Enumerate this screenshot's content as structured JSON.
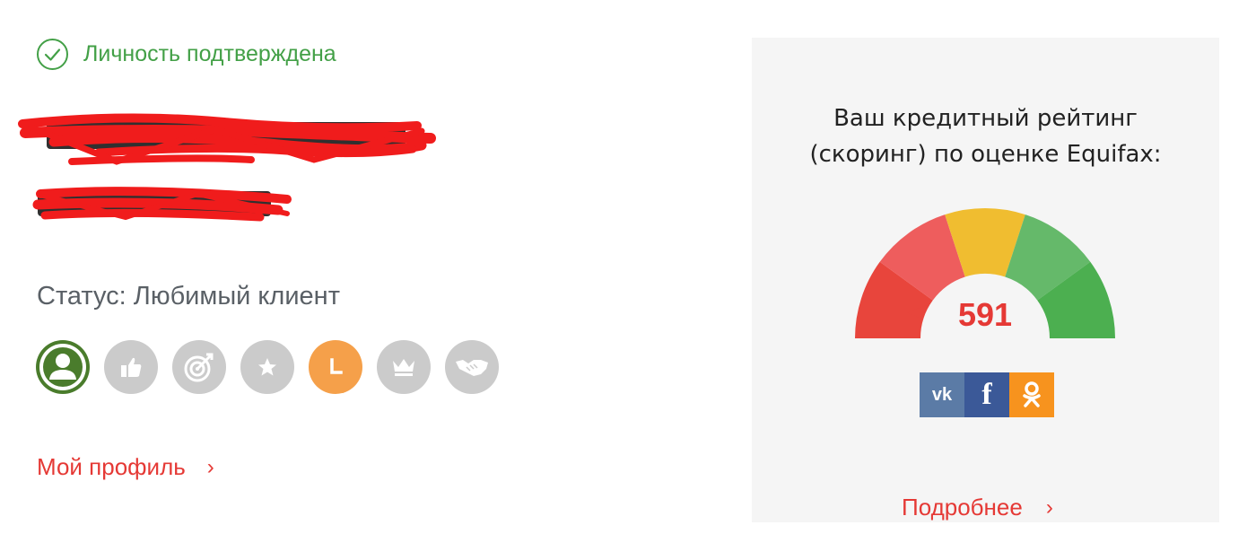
{
  "profile": {
    "verified_label": "Личность подтверждена",
    "status_text": "Статус: Любимый клиент",
    "badges": [
      {
        "icon": "user-icon",
        "state": "active",
        "color": "#4a7c2c"
      },
      {
        "icon": "thumbs-up-icon",
        "state": "inactive"
      },
      {
        "icon": "target-icon",
        "state": "inactive"
      },
      {
        "icon": "star-icon",
        "state": "inactive"
      },
      {
        "icon": "clock-icon",
        "state": "active",
        "color": "#f5a04a"
      },
      {
        "icon": "crown-icon",
        "state": "inactive"
      },
      {
        "icon": "handshake-icon",
        "state": "inactive"
      }
    ],
    "profile_link": "Мой профиль",
    "chevron": "›"
  },
  "rating": {
    "title_line1": "Ваш кредитный рейтинг",
    "title_line2": "(скоринг) по оценке Equifax:",
    "score": "591",
    "more_link": "Подробнее",
    "chevron": "›",
    "gauge_segment_colors": [
      "#e8453c",
      "#ee5d5d",
      "#f0bd30",
      "#65b96a",
      "#4caf50"
    ],
    "social": [
      {
        "icon": "vk-icon",
        "label": "vk",
        "color": "#5b7ba6"
      },
      {
        "icon": "facebook-icon",
        "label": "f",
        "color": "#3b5998"
      },
      {
        "icon": "odnoklassniki-icon",
        "color": "#f7931e"
      }
    ]
  },
  "colors": {
    "accent_red": "#e53935",
    "verified_green": "#43a047"
  }
}
